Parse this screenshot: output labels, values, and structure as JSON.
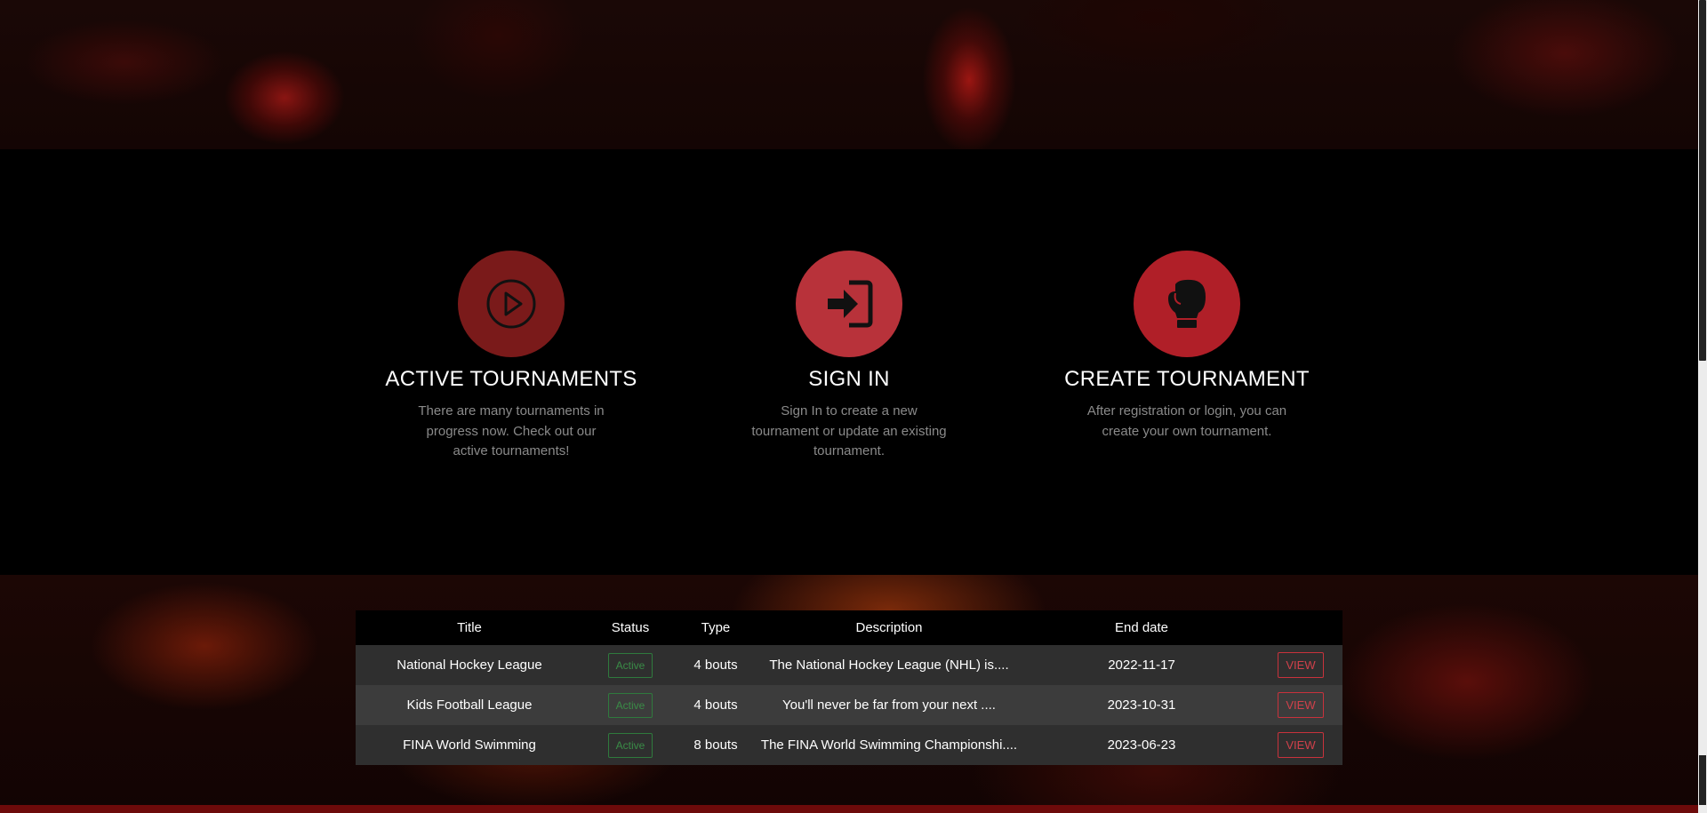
{
  "features": [
    {
      "icon": "play-circle-icon",
      "title": "ACTIVE TOURNAMENTS",
      "text": "There are many tournaments in progress now. Check out our active tournaments!",
      "color": "#7a1a1a"
    },
    {
      "icon": "sign-in-icon",
      "title": "SIGN IN",
      "text": "Sign In to create a new tournament or update an existing tournament.",
      "color": "#b8323a"
    },
    {
      "icon": "boxing-glove-icon",
      "title": "CREATE TOURNAMENT",
      "text": "After registration or login, you can create your own tournament.",
      "color": "#b01f28"
    }
  ],
  "table": {
    "headers": [
      "Title",
      "Status",
      "Type",
      "Description",
      "End date",
      ""
    ],
    "rows": [
      {
        "title": "National Hockey League",
        "status": "Active",
        "type": "4 bouts",
        "description": "The National Hockey League (NHL) is....",
        "end_date": "2022-11-17",
        "action": "VIEW"
      },
      {
        "title": "Kids Football League",
        "status": "Active",
        "type": "4 bouts",
        "description": "You'll never be far from your next ....",
        "end_date": "2023-10-31",
        "action": "VIEW"
      },
      {
        "title": "FINA World Swimming",
        "status": "Active",
        "type": "8 bouts",
        "description": "The FINA World Swimming Championshi....",
        "end_date": "2023-06-23",
        "action": "VIEW"
      }
    ]
  },
  "colors": {
    "accent": "#b8323a",
    "status_active": "#3a8c47",
    "view_button": "#d0404a"
  }
}
